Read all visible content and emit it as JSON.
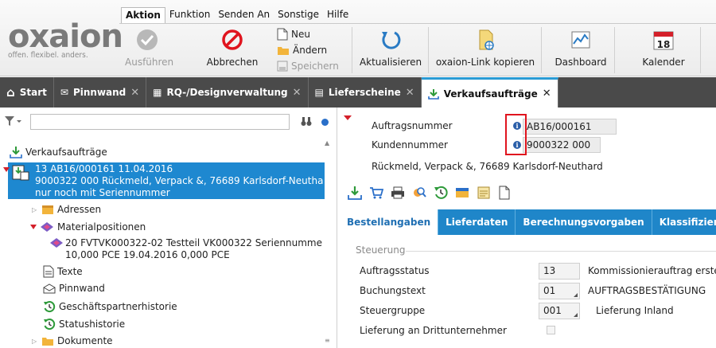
{
  "menu": {
    "tabs": [
      "Aktion",
      "Funktion",
      "Senden An",
      "Sonstige",
      "Hilfe"
    ]
  },
  "logo": {
    "word": "oxaion",
    "tagline": "offen. flexibel. anders."
  },
  "ribbon": {
    "execute": "Ausführen",
    "cancel": "Abbrechen",
    "new": "Neu",
    "edit": "Ändern",
    "save": "Speichern",
    "refresh": "Aktualisieren",
    "copy_link": "oxaion-Link kopieren",
    "dashboard": "Dashboard",
    "calendar": "Kalender",
    "calendar_day": "18"
  },
  "tabs": [
    {
      "label": "Start"
    },
    {
      "label": "Pinnwand"
    },
    {
      "label": "RQ-/Designverwaltung"
    },
    {
      "label": "Lieferscheine"
    },
    {
      "label": "Verkaufsaufträge"
    }
  ],
  "tree": {
    "root": "Verkaufsaufträge",
    "selected_line1": "13 AB16/000161 11.04.2016",
    "selected_line2": "9000322 000 Rückmeld, Verpack &, 76689 Karlsdorf-Neutha",
    "selected_line3": "nur noch mit Seriennummer",
    "adressen": "Adressen",
    "materialpositionen": "Materialpositionen",
    "position_line1": "20 FVTVK000322-02 Testteil VK000322 Seriennumme",
    "position_line2": "10,000 PCE 19.04.2016 0,000 PCE",
    "texte": "Texte",
    "pinnwand": "Pinnwand",
    "gp_historie": "Geschäftspartnerhistorie",
    "statushistorie": "Statushistorie",
    "dokumente": "Dokumente"
  },
  "header": {
    "auftragsnummer_label": "Auftragsnummer",
    "auftragsnummer_value": "AB16/000161",
    "kundennummer_label": "Kundennummer",
    "kundennummer_value": "9000322 000",
    "address": "Rückmeld, Verpack &, 76689 Karlsdorf-Neuthard"
  },
  "subtabs": [
    "Bestellangaben",
    "Lieferdaten",
    "Berechnungsvorgaben",
    "Klassifizierung"
  ],
  "section": {
    "title": "Steuerung",
    "rows": [
      {
        "label": "Auftragsstatus",
        "value": "13",
        "desc": "Kommissionierauftrag erste"
      },
      {
        "label": "Buchungstext",
        "value": "01",
        "desc": "AUFTRAGSBESTÄTIGUNG"
      },
      {
        "label": "Steuergruppe",
        "value": "001",
        "desc": "Lieferung Inland"
      },
      {
        "label": "Lieferung an Drittunternehmer"
      }
    ]
  },
  "colors": {
    "accent": "#1f86c9",
    "tabbar": "#4a4a4a",
    "highlight": "#e0141e"
  }
}
